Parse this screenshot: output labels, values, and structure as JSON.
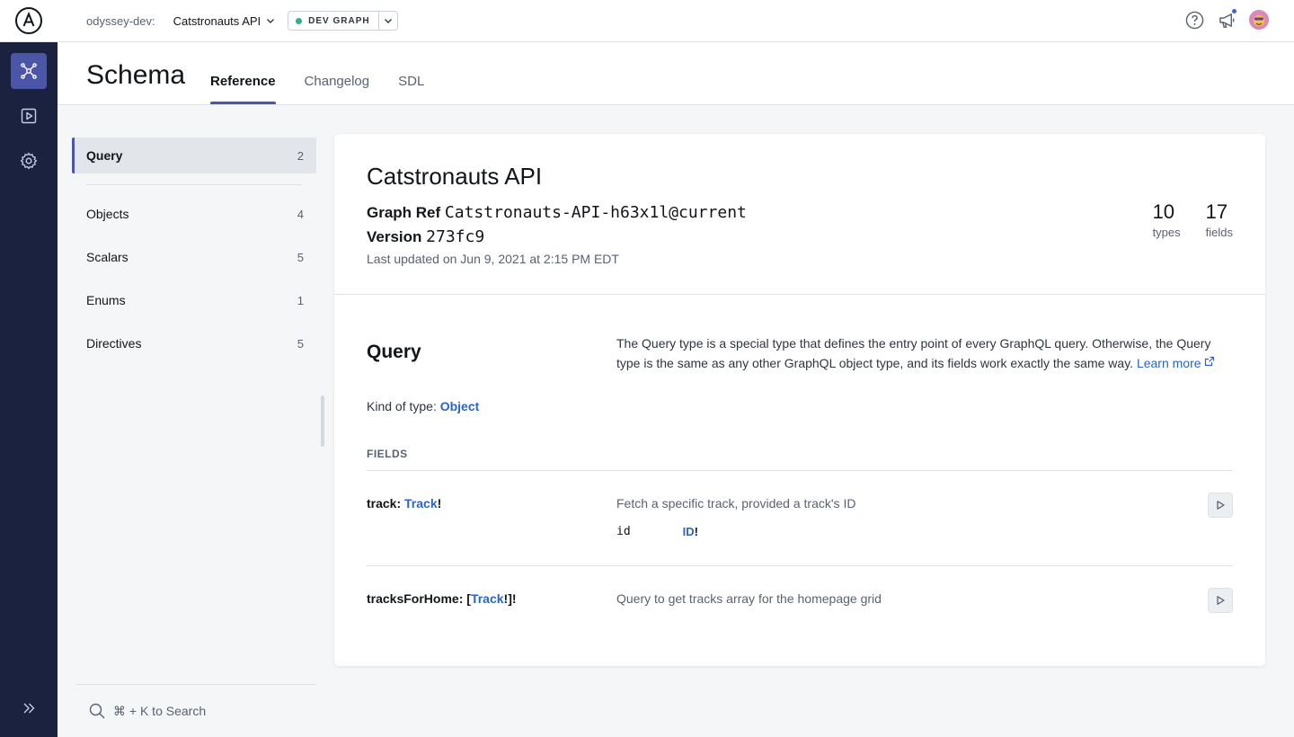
{
  "topbar": {
    "org": "odyssey-dev:",
    "graph_name": "Catstronauts API",
    "variant": "DEV GRAPH"
  },
  "header": {
    "title": "Schema",
    "tabs": [
      {
        "label": "Reference",
        "active": true
      },
      {
        "label": "Changelog",
        "active": false
      },
      {
        "label": "SDL",
        "active": false
      }
    ]
  },
  "typelist": {
    "items": [
      {
        "label": "Query",
        "count": "2"
      },
      {
        "label": "Objects",
        "count": "4"
      },
      {
        "label": "Scalars",
        "count": "5"
      },
      {
        "label": "Enums",
        "count": "1"
      },
      {
        "label": "Directives",
        "count": "5"
      }
    ]
  },
  "search": {
    "label": "⌘ + K to Search"
  },
  "card": {
    "title": "Catstronauts API",
    "graph_ref_label": "Graph Ref",
    "graph_ref": "Catstronauts-API-h63x1l@current",
    "version_label": "Version",
    "version": "273fc9",
    "updated": "Last updated on Jun 9, 2021 at 2:15 PM EDT",
    "stats": [
      {
        "num": "10",
        "label": "types"
      },
      {
        "num": "17",
        "label": "fields"
      }
    ],
    "query": {
      "title": "Query",
      "description": "The Query type is a special type that defines the entry point of every GraphQL query. Otherwise, the Query type is the same as any other GraphQL object type, and its fields work exactly the same way.",
      "learn_more": "Learn more",
      "kind_label": "Kind of type:",
      "kind_value": "Object"
    },
    "fields_label": "FIELDS",
    "fields": [
      {
        "name": "track:",
        "type": "Track",
        "suffix": "!",
        "description": "Fetch a specific track, provided a track's ID",
        "arg_name": "id",
        "arg_type": "ID",
        "arg_suffix": "!"
      },
      {
        "name": "tracksForHome:",
        "prefix": "[",
        "type": "Track",
        "suffix": "!]!",
        "description": "Query to get tracks array for the homepage grid"
      }
    ]
  },
  "colors": {
    "sidebar_bg": "#1b2240",
    "accent": "#4b57a6",
    "link": "#2a64c5",
    "status_green": "#36ad8a"
  }
}
